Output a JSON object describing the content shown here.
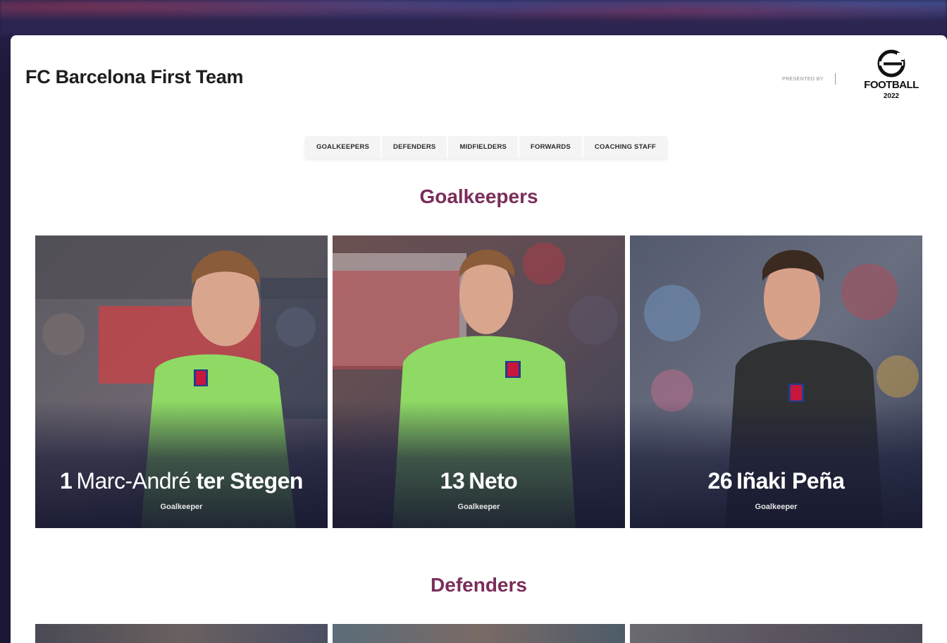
{
  "header": {
    "title": "FC Barcelona First Team",
    "sponsor_label": "PRESENTED BY",
    "logo_word": "FOOTBALL",
    "logo_year": "2022"
  },
  "tabs": [
    {
      "label": "GOALKEEPERS"
    },
    {
      "label": "DEFENDERS"
    },
    {
      "label": "MIDFIELDERS"
    },
    {
      "label": "FORWARDS"
    },
    {
      "label": "COACHING STAFF"
    }
  ],
  "sections": [
    {
      "title": "Goalkeepers",
      "players": [
        {
          "number": "1",
          "first_name": "Marc-André",
          "last_name": "ter Stegen",
          "role": "Goalkeeper",
          "kit_color": "#7ed957"
        },
        {
          "number": "13",
          "first_name": "",
          "last_name": "Neto",
          "role": "Goalkeeper",
          "kit_color": "#7ed957"
        },
        {
          "number": "26",
          "first_name": "",
          "last_name": "Iñaki Peña",
          "role": "Goalkeeper",
          "kit_color": "#2f3133"
        }
      ]
    },
    {
      "title": "Defenders",
      "players": []
    }
  ],
  "colors": {
    "accent": "#7a2d5a",
    "page_bg": "#1b1736",
    "card_bg": "#ffffff"
  }
}
